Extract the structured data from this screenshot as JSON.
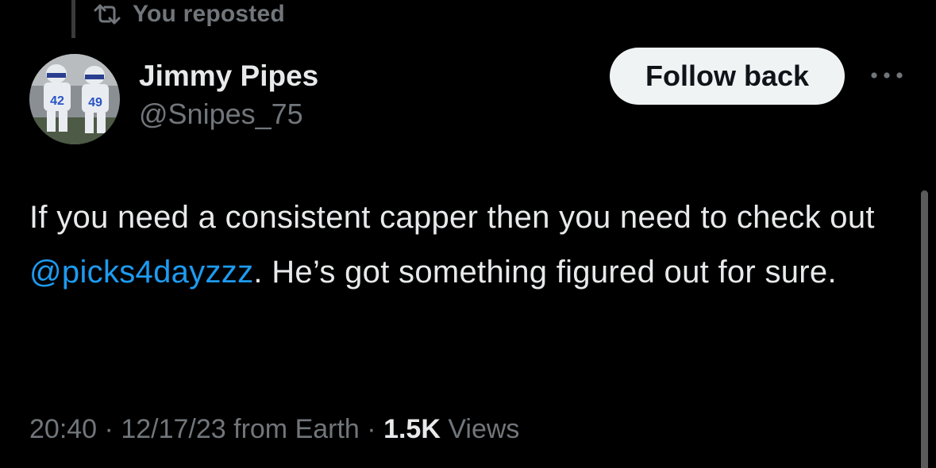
{
  "repost": {
    "label": "You reposted",
    "icon": "repost-icon"
  },
  "author": {
    "name": "Jimmy Pipes",
    "handle": "@Snipes_75",
    "avatar_icon": "avatar-photo"
  },
  "actions": {
    "follow_label": "Follow back",
    "more_icon": "more-dots-icon"
  },
  "tweet": {
    "text_before": "If you need a consistent capper then you need to check out ",
    "mention": "@picks4dayzzz",
    "text_after": ". He’s got something figured out for sure."
  },
  "meta": {
    "time": "20:40",
    "sep1": " · ",
    "date": "12/17/23",
    "from": " from Earth",
    "sep2": " · ",
    "views_count": "1.5K",
    "views_label": " Views"
  },
  "colors": {
    "background": "#000000",
    "text_primary": "#e7e9ea",
    "text_secondary": "#71767b",
    "link": "#1d9bf0",
    "button_bg": "#eff3f4"
  }
}
